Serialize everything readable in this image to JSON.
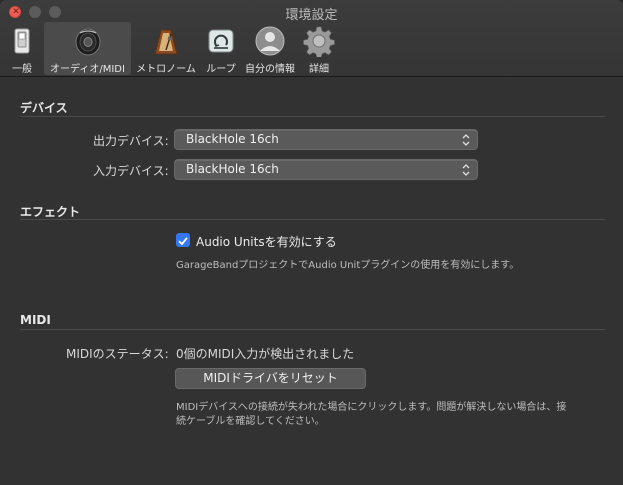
{
  "window": {
    "title": "環境設定"
  },
  "toolbar": {
    "tabs": [
      {
        "label": "一般",
        "icon": "general-switch-icon"
      },
      {
        "label": "オーディオ/MIDI",
        "icon": "speaker-icon"
      },
      {
        "label": "メトロノーム",
        "icon": "metronome-icon"
      },
      {
        "label": "ループ",
        "icon": "loop-icon"
      },
      {
        "label": "自分の情報",
        "icon": "person-icon"
      },
      {
        "label": "詳細",
        "icon": "gear-icon"
      }
    ],
    "selected": "オーディオ/MIDI"
  },
  "devices": {
    "title": "デバイス",
    "output_label": "出力デバイス:",
    "output_value": "BlackHole 16ch",
    "input_label": "入力デバイス:",
    "input_value": "BlackHole 16ch"
  },
  "effects": {
    "title": "エフェクト",
    "audio_units_label": "Audio Unitsを有効にする",
    "audio_units_checked": true,
    "audio_units_help": "GarageBandプロジェクトでAudio Unitプラグインの使用を有効にします。"
  },
  "midi": {
    "title": "MIDI",
    "status_label": "MIDIのステータス:",
    "status_value": "0個のMIDI入力が検出されました",
    "reset_button": "MIDIドライバをリセット",
    "help_line1": "MIDIデバイスへの接続が失われた場合にクリックします。問題が解決しない場合は、接",
    "help_line2": "続ケーブルを確認してください。"
  },
  "colors": {
    "accent": "#3478f6",
    "close": "#ec5f57",
    "background": "#323232",
    "selected_tab": "#4b4b4b"
  }
}
